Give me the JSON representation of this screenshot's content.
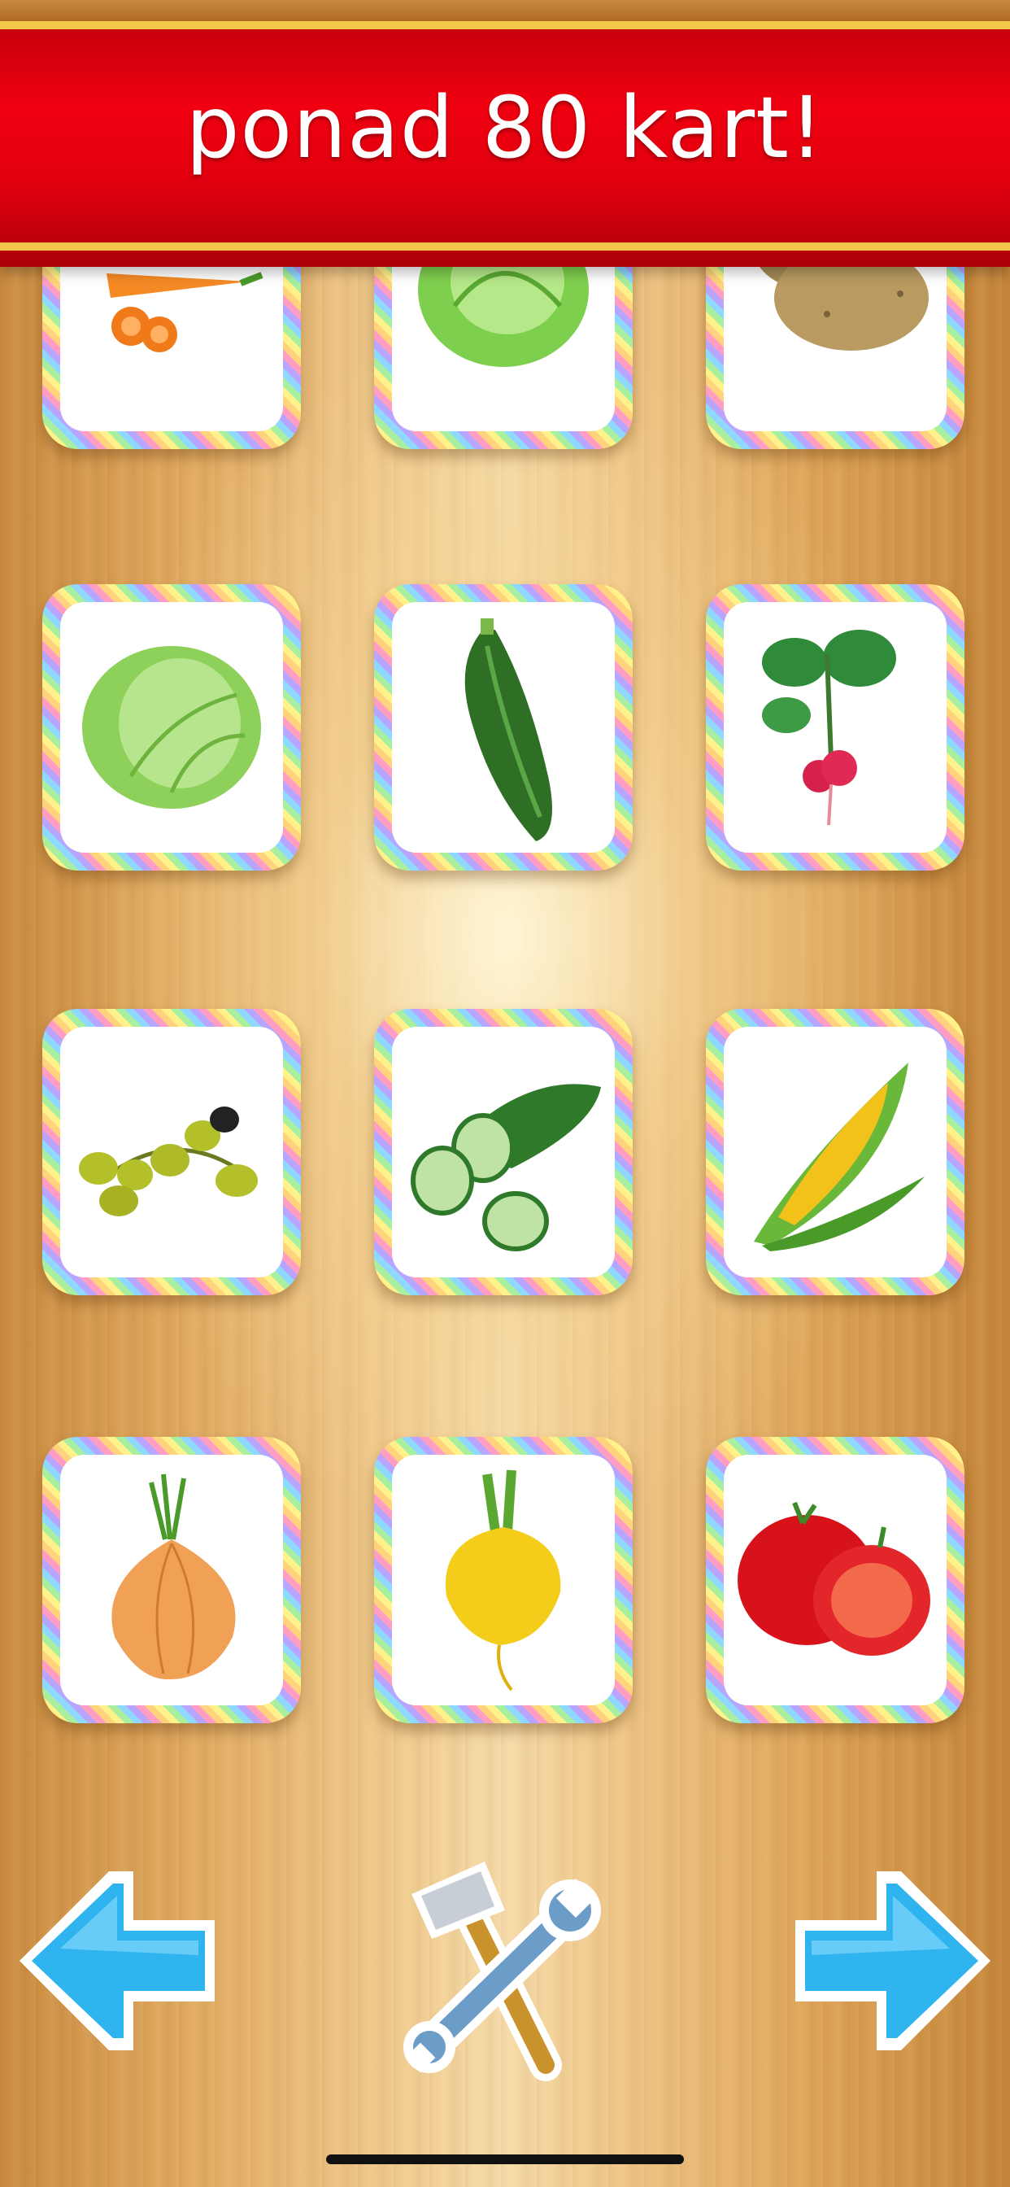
{
  "banner": {
    "title": "ponad 80 kart!"
  },
  "cards": [
    {
      "name": "carrot-card",
      "icon": "carrot-icon"
    },
    {
      "name": "lettuce-card",
      "icon": "lettuce-icon"
    },
    {
      "name": "potato-card",
      "icon": "potato-icon"
    },
    {
      "name": "cabbage-card",
      "icon": "cabbage-icon"
    },
    {
      "name": "zucchini-card",
      "icon": "zucchini-icon"
    },
    {
      "name": "radish-card",
      "icon": "radish-icon"
    },
    {
      "name": "olives-card",
      "icon": "olives-icon"
    },
    {
      "name": "cucumber-card",
      "icon": "cucumber-icon"
    },
    {
      "name": "corn-card",
      "icon": "corn-icon"
    },
    {
      "name": "onion-card",
      "icon": "onion-icon"
    },
    {
      "name": "turnip-card",
      "icon": "turnip-icon"
    },
    {
      "name": "tomato-card",
      "icon": "tomato-icon"
    }
  ],
  "navigation": {
    "previous": "arrow-left-icon",
    "settings": "hammer-wrench-icon",
    "next": "arrow-right-icon"
  },
  "colors": {
    "banner_red": "#e0000e",
    "banner_gold": "#f2c84b",
    "arrow_blue": "#2fb4f0"
  }
}
